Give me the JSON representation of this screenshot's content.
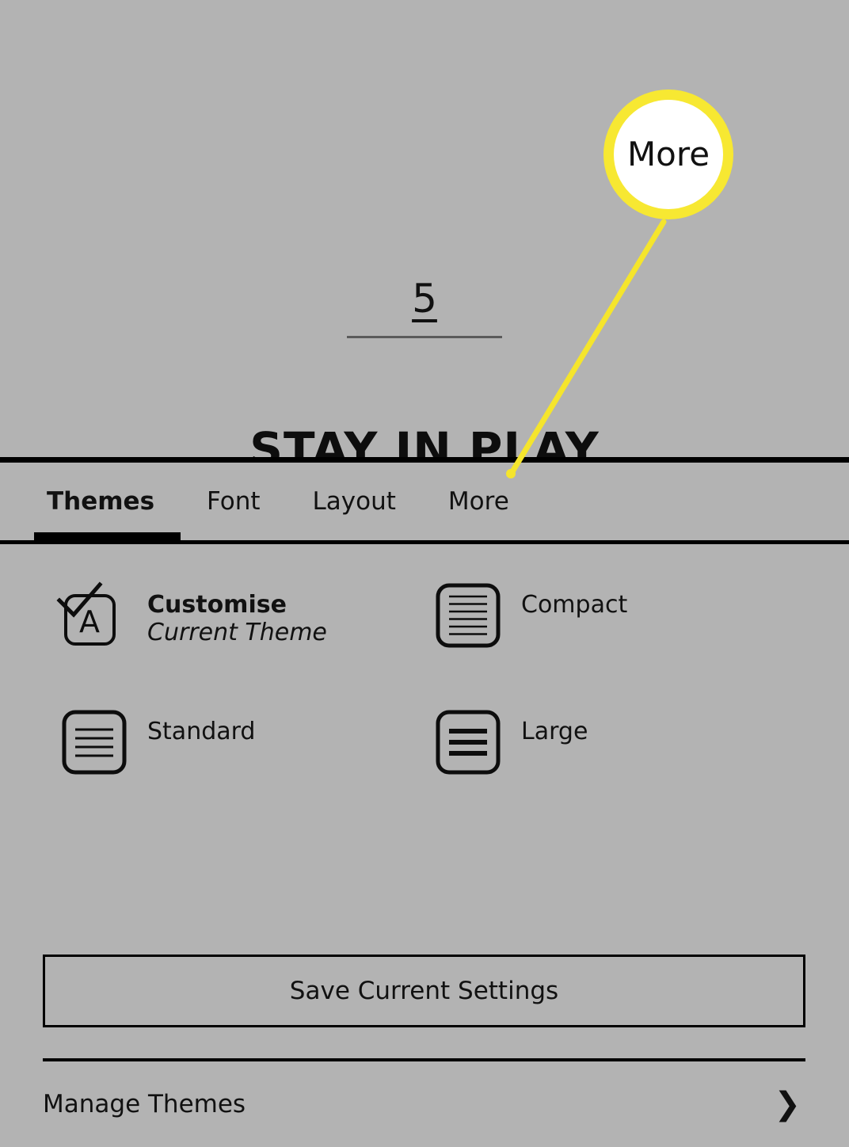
{
  "backdrop": {
    "page_number": "5",
    "heading": "STAY IN PLAY"
  },
  "callout": {
    "label": "More",
    "ring_color": "#f7e832",
    "fill_color": "#ffffff",
    "pointer_color": "#f5e52c"
  },
  "tabs": [
    {
      "id": "themes",
      "label": "Themes",
      "active": true
    },
    {
      "id": "font",
      "label": "Font",
      "active": false
    },
    {
      "id": "layout",
      "label": "Layout",
      "active": false
    },
    {
      "id": "more",
      "label": "More",
      "active": false
    }
  ],
  "themes": [
    {
      "id": "customise",
      "label": "Customise",
      "sublabel": "Current Theme",
      "icon": "document-a-check-icon",
      "selected": true
    },
    {
      "id": "compact",
      "label": "Compact",
      "sublabel": "",
      "icon": "document-compact-lines-icon",
      "selected": false
    },
    {
      "id": "standard",
      "label": "Standard",
      "sublabel": "",
      "icon": "document-standard-lines-icon",
      "selected": false
    },
    {
      "id": "large",
      "label": "Large",
      "sublabel": "",
      "icon": "document-large-lines-icon",
      "selected": false
    }
  ],
  "actions": {
    "save_label": "Save Current Settings",
    "manage_themes_label": "Manage Themes",
    "manage_themes_chevron": "❯"
  },
  "colors": {
    "background": "#b3b3b3",
    "text": "#111111",
    "rule": "#000000",
    "highlight": "#f7e832"
  }
}
